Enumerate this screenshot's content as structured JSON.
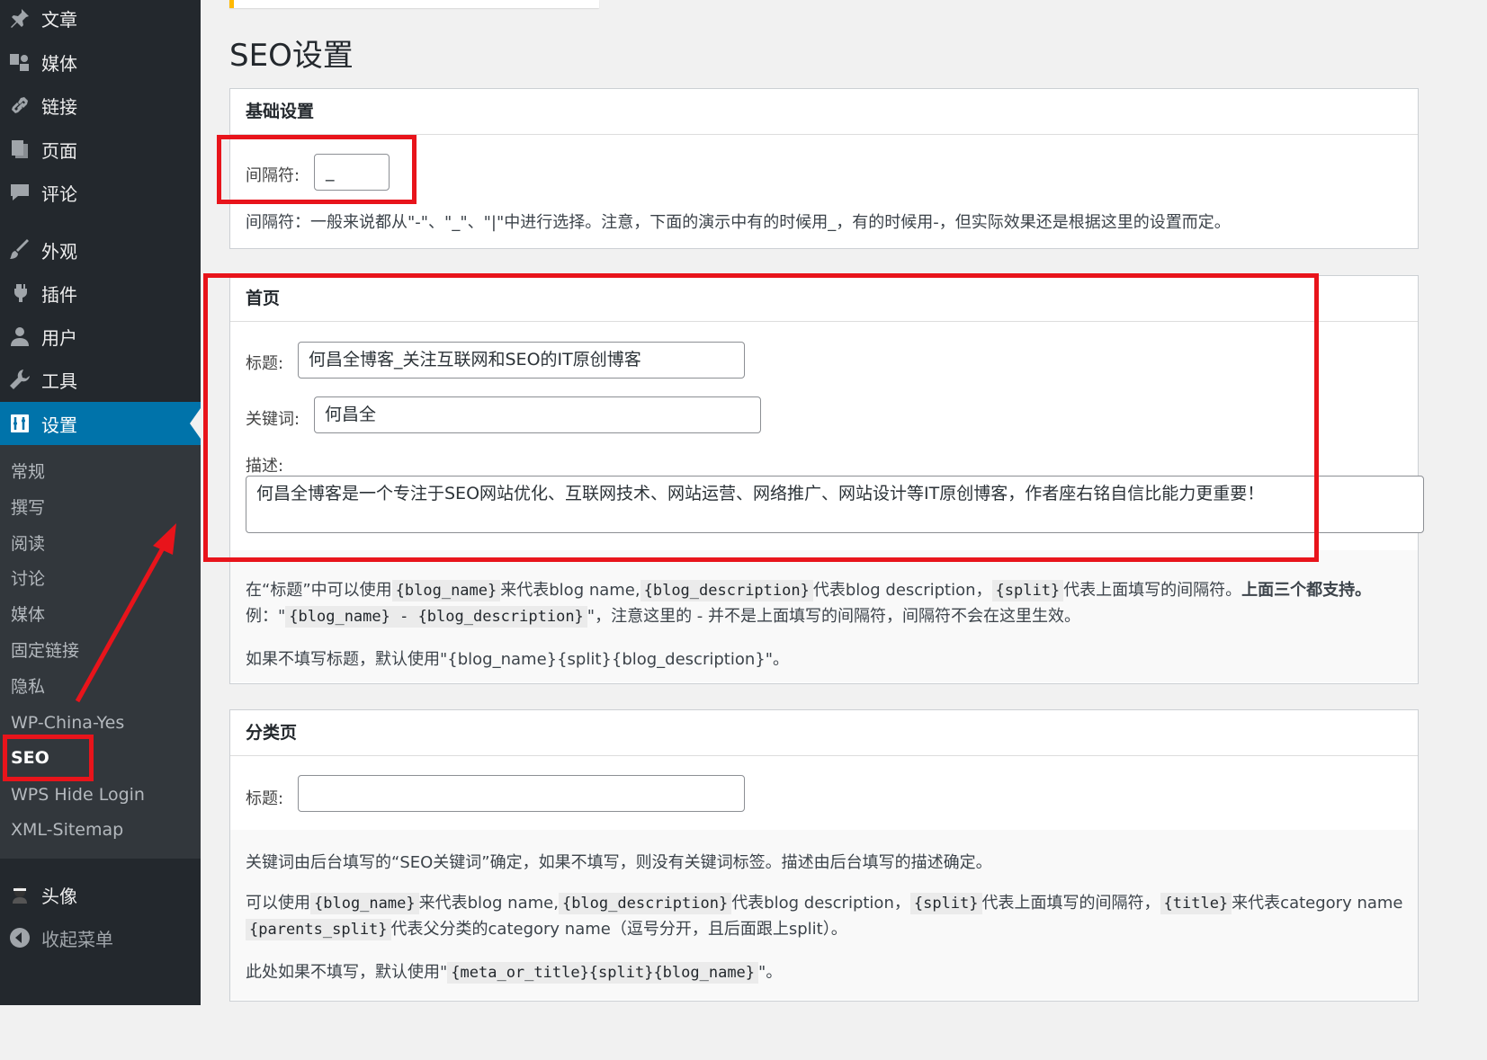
{
  "sidebar": {
    "menu": [
      {
        "label": "文章",
        "icon": "pin-icon"
      },
      {
        "label": "媒体",
        "icon": "media-icon"
      },
      {
        "label": "链接",
        "icon": "link-icon"
      },
      {
        "label": "页面",
        "icon": "page-icon"
      },
      {
        "label": "评论",
        "icon": "comment-icon"
      },
      {
        "label": "外观",
        "icon": "brush-icon"
      },
      {
        "label": "插件",
        "icon": "plugin-icon"
      },
      {
        "label": "用户",
        "icon": "user-icon"
      },
      {
        "label": "工具",
        "icon": "wrench-icon"
      },
      {
        "label": "设置",
        "icon": "settings-icon",
        "current": true
      }
    ],
    "submenu": [
      "常规",
      "撰写",
      "阅读",
      "讨论",
      "媒体",
      "固定链接",
      "隐私",
      "WP-China-Yes",
      "SEO",
      "WPS Hide Login",
      "XML-Sitemap"
    ],
    "current_submenu": "SEO",
    "footer": [
      {
        "label": "头像",
        "icon": "avatar-icon"
      },
      {
        "label": "收起菜单",
        "icon": "collapse-icon"
      }
    ]
  },
  "page": {
    "title": "SEO设置"
  },
  "basic": {
    "heading": "基础设置",
    "separator_label": "间隔符:",
    "separator_value": "_",
    "help": "间隔符：一般来说都从\"-\"、\"_\"、\"|\"中进行选择。注意，下面的演示中有的时候用_，有的时候用-，但实际效果还是根据这里的设置而定。"
  },
  "home": {
    "heading": "首页",
    "title_label": "标题:",
    "title_value": "何昌全博客_关注互联网和SEO的IT原创博客",
    "keywords_label": "关键词:",
    "keywords_value": "何昌全",
    "desc_label": "描述:",
    "desc_value": "何昌全博客是一个专注于SEO网站优化、互联网技术、网站运营、网络推广、网站设计等IT原创博客，作者座右铭自信比能力更重要！",
    "help1_a": "在“标题”中可以使用",
    "help1_code1": "{blog_name}",
    "help1_b": "来代表blog name,",
    "help1_code2": "{blog_description}",
    "help1_c": "代表blog description，",
    "help1_code3": "{split}",
    "help1_d": "代表上面填写的间隔符。",
    "help1_bold": "上面三个都支持。",
    "help2_a": "例：\"",
    "help2_code": "{blog_name} - {blog_description}",
    "help2_b": "\"，注意这里的 - 并不是上面填写的间隔符，间隔符不会在这里生效。",
    "help3": "如果不填写标题，默认使用\"{blog_name}{split}{blog_description}\"。"
  },
  "category": {
    "heading": "分类页",
    "title_label": "标题:",
    "title_value": "",
    "help1": "关键词由后台填写的“SEO关键词”确定，如果不填写，则没有关键词标签。描述由后台填写的描述确定。",
    "help2_a": "可以使用",
    "help2_code1": "{blog_name}",
    "help2_b": "来代表blog name,",
    "help2_code2": "{blog_description}",
    "help2_c": "代表blog description，",
    "help2_code3": "{split}",
    "help2_d": "代表上面填写的间隔符，",
    "help2_code4": "{title}",
    "help2_e": "来代表category name",
    "help3_code": "{parents_split}",
    "help3_a": "代表父分类的category name（逗号分开，且后面跟上split）。",
    "help4_a": "此处如果不填写，默认使用\"",
    "help4_code": "{meta_or_title}{split}{blog_name}",
    "help4_b": "\"。"
  },
  "annotation_color": "#e8141b",
  "accent_color": "#0073aa"
}
